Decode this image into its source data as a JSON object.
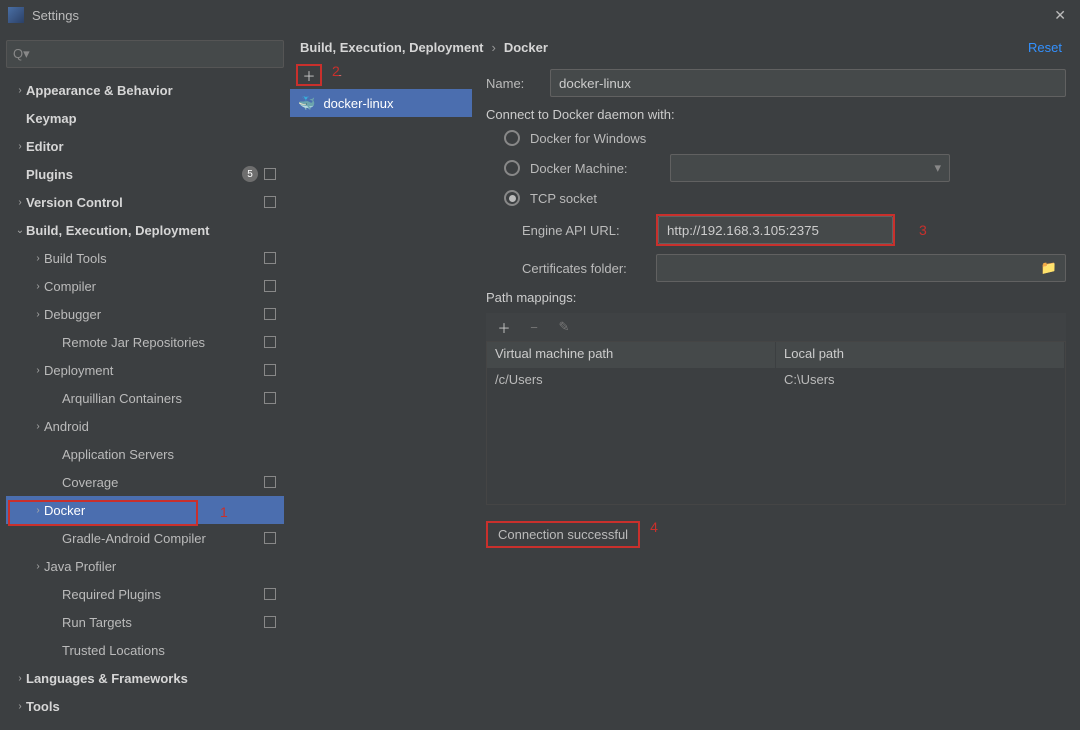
{
  "window": {
    "title": "Settings"
  },
  "search": {
    "placeholder": "Q▾"
  },
  "tree": [
    {
      "label": "Appearance & Behavior",
      "depth": 0,
      "arrow": "›",
      "bold": true
    },
    {
      "label": "Keymap",
      "depth": 0,
      "arrow": "",
      "bold": true
    },
    {
      "label": "Editor",
      "depth": 0,
      "arrow": "›",
      "bold": true
    },
    {
      "label": "Plugins",
      "depth": 0,
      "arrow": "",
      "bold": true,
      "badge": "5",
      "square": true
    },
    {
      "label": "Version Control",
      "depth": 0,
      "arrow": "›",
      "bold": true,
      "square": true
    },
    {
      "label": "Build, Execution, Deployment",
      "depth": 0,
      "arrow": "⌄",
      "bold": true
    },
    {
      "label": "Build Tools",
      "depth": 1,
      "arrow": "›",
      "square": true
    },
    {
      "label": "Compiler",
      "depth": 1,
      "arrow": "›",
      "square": true
    },
    {
      "label": "Debugger",
      "depth": 1,
      "arrow": "›",
      "square": true
    },
    {
      "label": "Remote Jar Repositories",
      "depth": 2,
      "arrow": "",
      "square": true
    },
    {
      "label": "Deployment",
      "depth": 1,
      "arrow": "›",
      "square": true
    },
    {
      "label": "Arquillian Containers",
      "depth": 2,
      "arrow": "",
      "square": true
    },
    {
      "label": "Android",
      "depth": 1,
      "arrow": "›"
    },
    {
      "label": "Application Servers",
      "depth": 2,
      "arrow": ""
    },
    {
      "label": "Coverage",
      "depth": 2,
      "arrow": "",
      "square": true
    },
    {
      "label": "Docker",
      "depth": 1,
      "arrow": "›",
      "selected": true
    },
    {
      "label": "Gradle-Android Compiler",
      "depth": 2,
      "arrow": "",
      "square": true
    },
    {
      "label": "Java Profiler",
      "depth": 1,
      "arrow": "›"
    },
    {
      "label": "Required Plugins",
      "depth": 2,
      "arrow": "",
      "square": true
    },
    {
      "label": "Run Targets",
      "depth": 2,
      "arrow": "",
      "square": true
    },
    {
      "label": "Trusted Locations",
      "depth": 2,
      "arrow": ""
    },
    {
      "label": "Languages & Frameworks",
      "depth": 0,
      "arrow": "›",
      "bold": true
    },
    {
      "label": "Tools",
      "depth": 0,
      "arrow": "›",
      "bold": true
    }
  ],
  "breadcrumb": {
    "a": "Build, Execution, Deployment",
    "b": "Docker",
    "reset": "Reset"
  },
  "list": {
    "selected": "docker-linux"
  },
  "detail": {
    "name_label": "Name:",
    "name_value": "docker-linux",
    "connect_label": "Connect to Docker daemon with:",
    "radio_windows": "Docker for Windows",
    "radio_machine": "Docker Machine:",
    "radio_tcp": "TCP socket",
    "engine_label": "Engine API URL:",
    "engine_value": "http://192.168.3.105:2375",
    "cert_label": "Certificates folder:",
    "pm_label": "Path mappings:",
    "table": {
      "h1": "Virtual machine path",
      "h2": "Local path",
      "r1c1": "/c/Users",
      "r1c2": "C:\\Users"
    },
    "status": "Connection successful"
  },
  "annotations": {
    "a1": "1",
    "a2": "2",
    "a3": "3",
    "a4": "4"
  }
}
